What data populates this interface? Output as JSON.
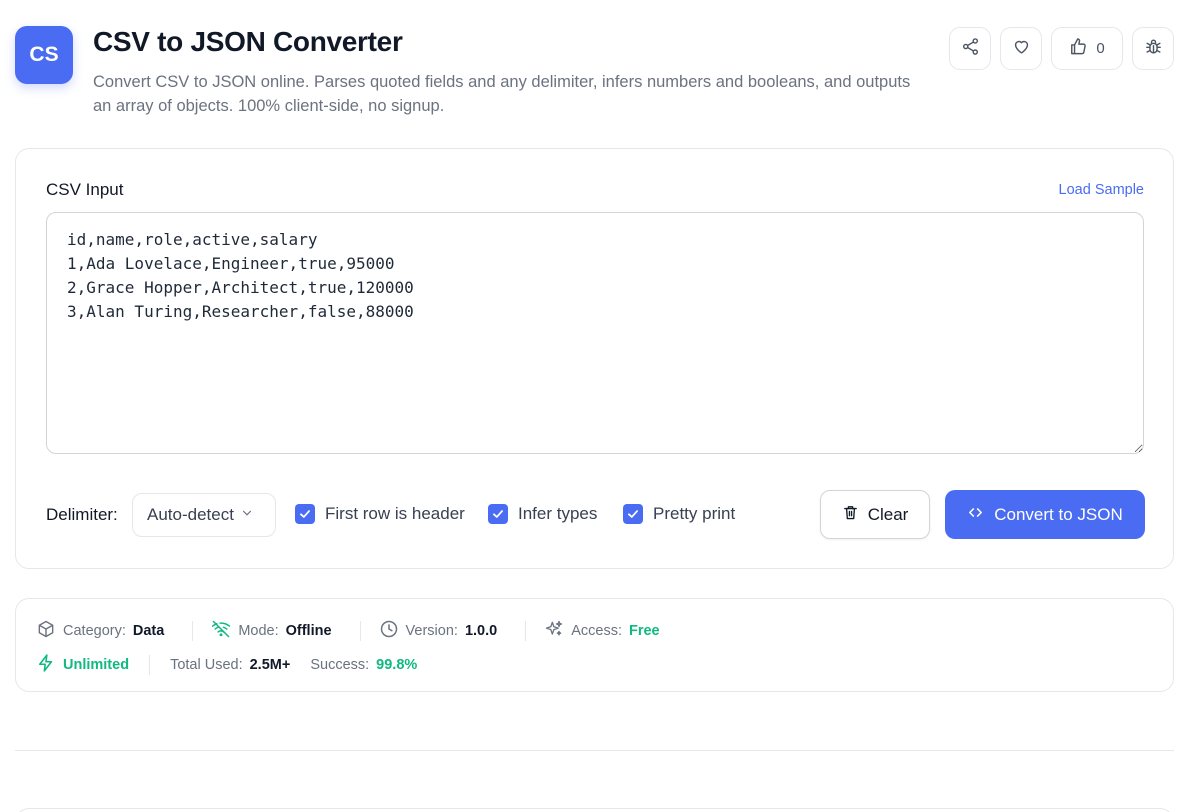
{
  "header": {
    "logo_text": "CS",
    "title": "CSV to JSON Converter",
    "description": "Convert CSV to JSON online. Parses quoted fields and any delimiter, infers numbers and booleans, and outputs an array of objects. 100% client-side, no signup.",
    "like_count": "0",
    "icons": [
      "share-icon",
      "heart-icon",
      "thumbs-up-icon",
      "bug-icon"
    ]
  },
  "input": {
    "label": "CSV Input",
    "load_sample": "Load Sample",
    "value": "id,name,role,active,salary\n1,Ada Lovelace,Engineer,true,95000\n2,Grace Hopper,Architect,true,120000\n3,Alan Turing,Researcher,false,88000"
  },
  "options": {
    "delimiter_label": "Delimiter:",
    "delimiter_value": "Auto-detect",
    "first_row_header": "First row is header",
    "infer_types": "Infer types",
    "pretty_print": "Pretty print"
  },
  "actions": {
    "clear": "Clear",
    "convert": "Convert to JSON"
  },
  "meta": {
    "category_label": "Category:",
    "category_value": "Data",
    "mode_label": "Mode:",
    "mode_value": "Offline",
    "version_label": "Version:",
    "version_value": "1.0.0",
    "access_label": "Access:",
    "access_value": "Free",
    "unlimited": "Unlimited",
    "total_used_label": "Total Used:",
    "total_used_value": "2.5M+",
    "success_label": "Success:",
    "success_value": "99.8%"
  },
  "colors": {
    "accent": "#4a6cf2",
    "success": "#10b981"
  }
}
